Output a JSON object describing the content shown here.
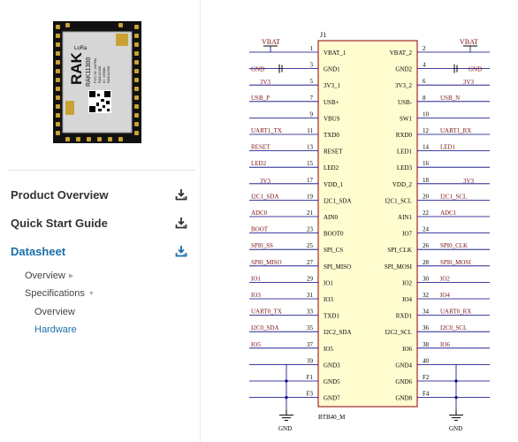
{
  "module_label": {
    "brand": "RAK",
    "model": "RAK11300",
    "tag": "LoRa",
    "extra_lines": [
      "FCC ID: 2AF6B-",
      "RAK11300",
      "IC: 25908-",
      "RAK11300"
    ]
  },
  "sidebar": {
    "items": [
      {
        "label": "Product Overview",
        "active": false
      },
      {
        "label": "Quick Start Guide",
        "active": false
      },
      {
        "label": "Datasheet",
        "active": true
      }
    ],
    "sub_items": [
      {
        "label": "Overview",
        "caret": "▶",
        "active": false
      },
      {
        "label": "Specifications",
        "caret": "▼",
        "active": false
      },
      {
        "label": "Overview",
        "caret": "",
        "active": false
      },
      {
        "label": "Hardware",
        "caret": "",
        "active": true
      }
    ],
    "icons": {
      "download": "download-icon"
    },
    "colors": {
      "accent": "#1a6fa8",
      "text": "#333333"
    }
  },
  "schematic": {
    "ref": "J1",
    "part": "BTB40_M",
    "top_left_power": "VBAT",
    "top_right_power": "VBAT",
    "colors": {
      "body": "#fffdd0",
      "outline": "#8b0000",
      "wire": "#000080",
      "net": "#7b1010"
    },
    "rows": [
      {
        "lnet": "",
        "lpin": "1",
        "lname": "VBAT_1",
        "rname": "VBAT_2",
        "rpin": "2",
        "rnet": ""
      },
      {
        "lnet": "GND",
        "lpin": "3",
        "lname": "GND1",
        "rname": "GND2",
        "rpin": "4",
        "rnet": "GND"
      },
      {
        "lnet": "3V3",
        "lpin": "5",
        "lname": "3V3_1",
        "rname": "3V3_2",
        "rpin": "6",
        "rnet": "3V3"
      },
      {
        "lnet": "USB_P",
        "lpin": "7",
        "lname": "USB+",
        "rname": "USB-",
        "rpin": "8",
        "rnet": "USB_N"
      },
      {
        "lnet": "",
        "lpin": "9",
        "lname": "VBUS",
        "rname": "SW1",
        "rpin": "10",
        "rnet": ""
      },
      {
        "lnet": "UART1_TX",
        "lpin": "11",
        "lname": "TXD0",
        "rname": "RXD0",
        "rpin": "12",
        "rnet": "UART1_RX"
      },
      {
        "lnet": "RESET",
        "lpin": "13",
        "lname": "RESET",
        "rname": "LED1",
        "rpin": "14",
        "rnet": "LED1"
      },
      {
        "lnet": "LED2",
        "lpin": "15",
        "lname": "LED2",
        "rname": "LED3",
        "rpin": "16",
        "rnet": ""
      },
      {
        "lnet": "3V3",
        "lpin": "17",
        "lname": "VDD_1",
        "rname": "VDD_2",
        "rpin": "18",
        "rnet": "3V3"
      },
      {
        "lnet": "I2C1_SDA",
        "lpin": "19",
        "lname": "I2C1_SDA",
        "rname": "I2C1_SCL",
        "rpin": "20",
        "rnet": "I2C1_SCL"
      },
      {
        "lnet": "ADC0",
        "lpin": "21",
        "lname": "AIN0",
        "rname": "AIN1",
        "rpin": "22",
        "rnet": "ADC1"
      },
      {
        "lnet": "BOOT",
        "lpin": "23",
        "lname": "BOOT0",
        "rname": "IO7",
        "rpin": "24",
        "rnet": ""
      },
      {
        "lnet": "SPI0_SS",
        "lpin": "25",
        "lname": "SPI_CS",
        "rname": "SPI_CLK",
        "rpin": "26",
        "rnet": "SPI0_CLK"
      },
      {
        "lnet": "SPI0_MISO",
        "lpin": "27",
        "lname": "SPI_MISO",
        "rname": "SPI_MOSI",
        "rpin": "28",
        "rnet": "SPI0_MOSI"
      },
      {
        "lnet": "IO1",
        "lpin": "29",
        "lname": "IO1",
        "rname": "IO2",
        "rpin": "30",
        "rnet": "IO2"
      },
      {
        "lnet": "IO3",
        "lpin": "31",
        "lname": "IO3",
        "rname": "IO4",
        "rpin": "32",
        "rnet": "IO4"
      },
      {
        "lnet": "UART0_TX",
        "lpin": "33",
        "lname": "TXD1",
        "rname": "RXD1",
        "rpin": "34",
        "rnet": "UART0_RX"
      },
      {
        "lnet": "I2C0_SDA",
        "lpin": "35",
        "lname": "I2C2_SDA",
        "rname": "I2C2_SCL",
        "rpin": "36",
        "rnet": "I2C0_SCL"
      },
      {
        "lnet": "IO5",
        "lpin": "37",
        "lname": "IO5",
        "rname": "IO6",
        "rpin": "38",
        "rnet": "IO6"
      },
      {
        "lnet": "",
        "lpin": "39",
        "lname": "GND3",
        "rname": "GND4",
        "rpin": "40",
        "rnet": ""
      },
      {
        "lnet": "",
        "lpin": "F1",
        "lname": "GND5",
        "rname": "GND6",
        "rpin": "F2",
        "rnet": ""
      },
      {
        "lnet": "",
        "lpin": "F3",
        "lname": "GND7",
        "rname": "GND8",
        "rpin": "F4",
        "rnet": ""
      }
    ],
    "bottom_left_net": "GND",
    "bottom_right_net": "GND"
  }
}
